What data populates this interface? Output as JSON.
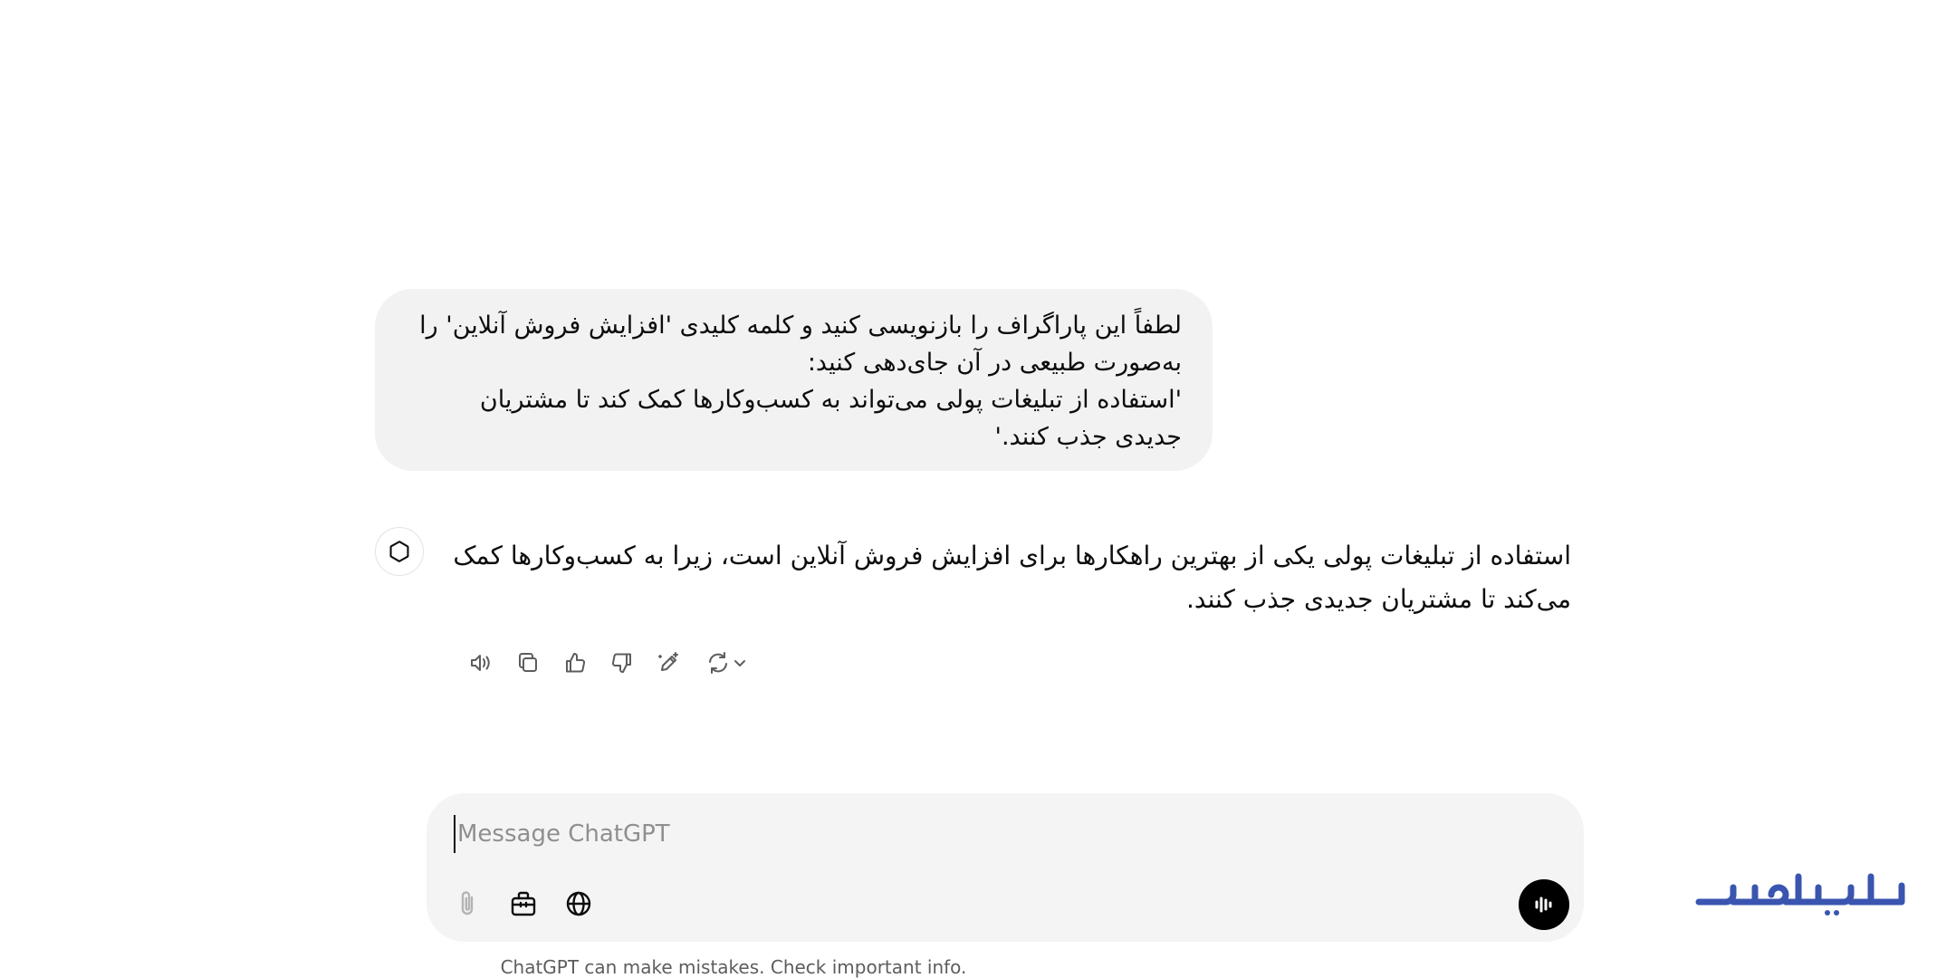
{
  "conversation": {
    "user_message": {
      "lines": [
        "لطفاً این پاراگراف را بازنویسی کنید و کلمه کلیدی 'افزایش فروش آنلاین' را",
        "به‌صورت طبیعی در آن جای‌دهی کنید:",
        "'استفاده از تبلیغات پولی می‌تواند به کسب‌وکارها کمک کند تا مشتریان",
        "جدیدی جذب کنند.'"
      ]
    },
    "assistant_message": {
      "lines": [
        "استفاده از تبلیغات پولی یکی از بهترین راهکارها برای افزایش فروش آنلاین است، زیرا به کسب‌وکارها کمک",
        "می‌کند تا مشتریان جدیدی جذب کنند."
      ]
    }
  },
  "message_actions": {
    "icons": [
      "speaker-icon",
      "copy-icon",
      "thumbs-up-icon",
      "thumbs-down-icon",
      "edit-canvas-icon",
      "regenerate-icon",
      "chevron-down-icon"
    ]
  },
  "composer": {
    "placeholder": "Message ChatGPT",
    "value": ""
  },
  "footer": {
    "disclaimer": "ChatGPT can make mistakes. Check important info."
  },
  "brand": {
    "logo_color": "#3a55b0"
  }
}
